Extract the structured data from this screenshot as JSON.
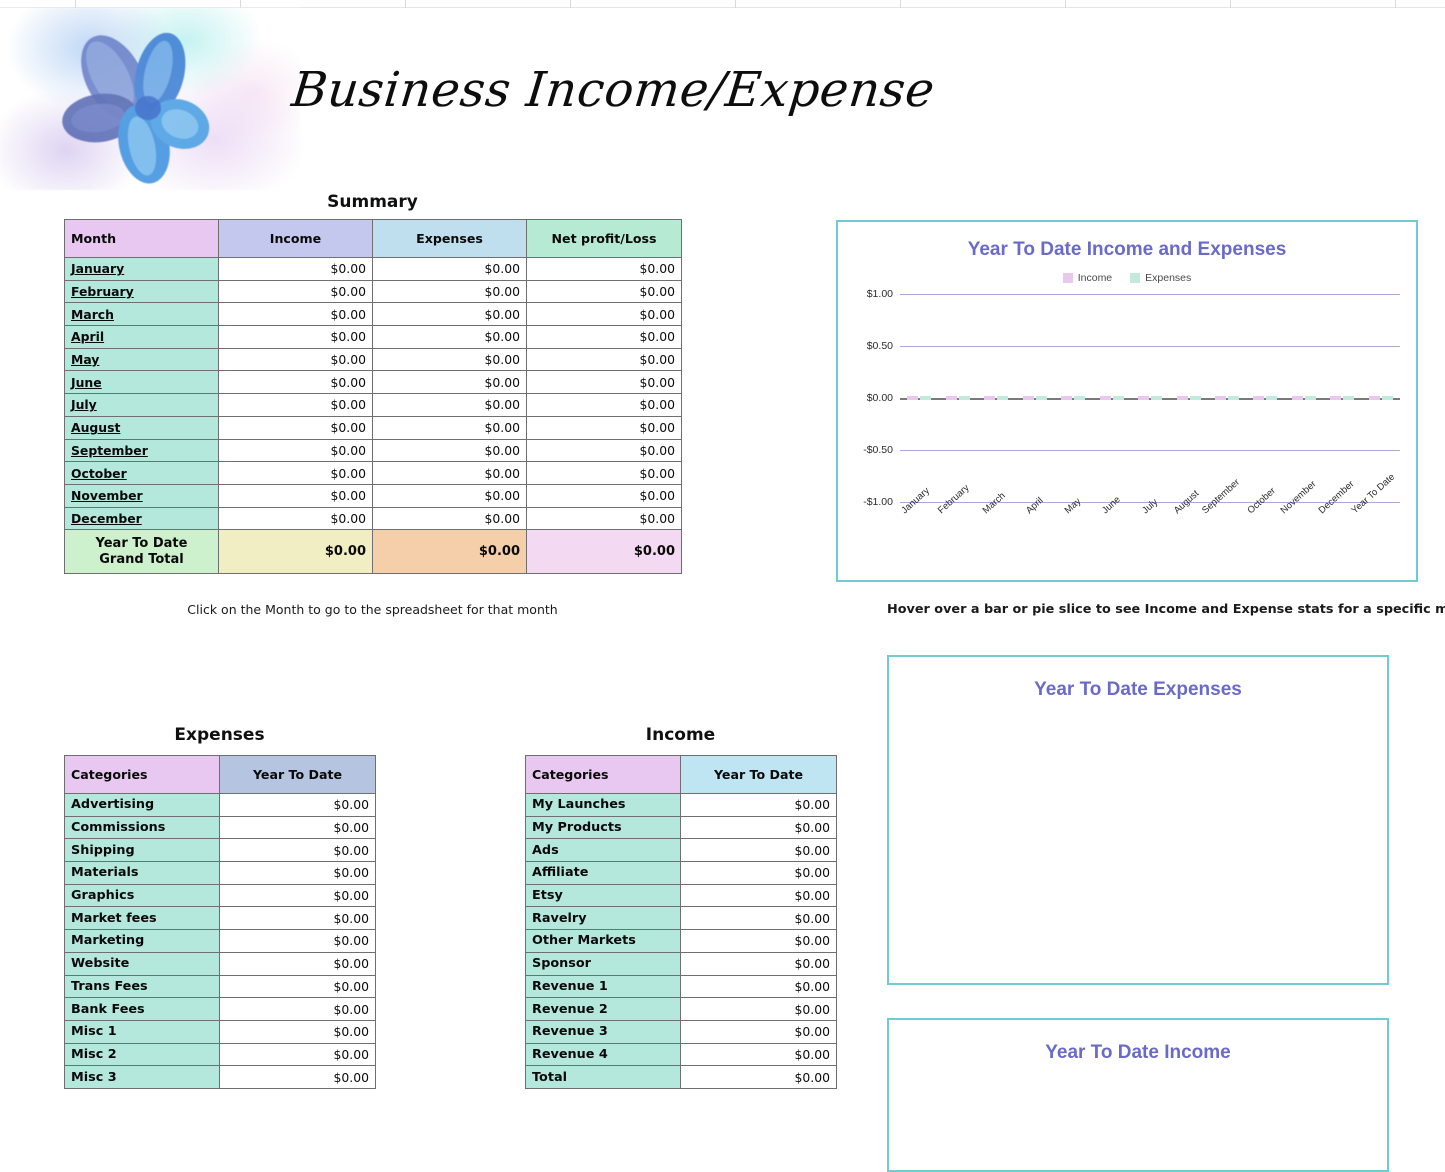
{
  "header": {
    "title": "Business Income/Expense",
    "logo_icon": "watercolor-flower-icon"
  },
  "summary": {
    "caption": "Summary",
    "columns": [
      "Month",
      "Income",
      "Expenses",
      "Net profit/Loss"
    ],
    "rows": [
      {
        "month": "January",
        "income": "$0.00",
        "expenses": "$0.00",
        "net": "$0.00"
      },
      {
        "month": "February",
        "income": "$0.00",
        "expenses": "$0.00",
        "net": "$0.00"
      },
      {
        "month": "March",
        "income": "$0.00",
        "expenses": "$0.00",
        "net": "$0.00"
      },
      {
        "month": "April",
        "income": "$0.00",
        "expenses": "$0.00",
        "net": "$0.00"
      },
      {
        "month": "May",
        "income": "$0.00",
        "expenses": "$0.00",
        "net": "$0.00"
      },
      {
        "month": "June",
        "income": "$0.00",
        "expenses": "$0.00",
        "net": "$0.00"
      },
      {
        "month": "July",
        "income": "$0.00",
        "expenses": "$0.00",
        "net": "$0.00"
      },
      {
        "month": "August",
        "income": "$0.00",
        "expenses": "$0.00",
        "net": "$0.00"
      },
      {
        "month": "September",
        "income": "$0.00",
        "expenses": "$0.00",
        "net": "$0.00"
      },
      {
        "month": "October",
        "income": "$0.00",
        "expenses": "$0.00",
        "net": "$0.00"
      },
      {
        "month": "November",
        "income": "$0.00",
        "expenses": "$0.00",
        "net": "$0.00"
      },
      {
        "month": "December",
        "income": "$0.00",
        "expenses": "$0.00",
        "net": "$0.00"
      }
    ],
    "total": {
      "label_line1": "Year To Date",
      "label_line2": "Grand Total",
      "income": "$0.00",
      "expenses": "$0.00",
      "net": "$0.00"
    },
    "footnote": "Click on the Month to go to the spreadsheet for that month"
  },
  "chart_note": "Hover over a bar or pie slice to see Income and Expense stats for a specific month",
  "expenses_table": {
    "caption": "Expenses",
    "columns": [
      "Categories",
      "Year To Date"
    ],
    "rows": [
      {
        "name": "Advertising",
        "value": "$0.00"
      },
      {
        "name": "Commissions",
        "value": "$0.00"
      },
      {
        "name": "Shipping",
        "value": "$0.00"
      },
      {
        "name": "Materials",
        "value": "$0.00"
      },
      {
        "name": "Graphics",
        "value": "$0.00"
      },
      {
        "name": "Market fees",
        "value": "$0.00"
      },
      {
        "name": "Marketing",
        "value": "$0.00"
      },
      {
        "name": "Website",
        "value": "$0.00"
      },
      {
        "name": "Trans Fees",
        "value": "$0.00"
      },
      {
        "name": "Bank Fees",
        "value": "$0.00"
      },
      {
        "name": "Misc 1",
        "value": "$0.00"
      },
      {
        "name": "Misc 2",
        "value": "$0.00"
      },
      {
        "name": "Misc 3",
        "value": "$0.00"
      }
    ]
  },
  "income_table": {
    "caption": "Income",
    "columns": [
      "Categories",
      "Year To Date"
    ],
    "rows": [
      {
        "name": "My Launches",
        "value": "$0.00"
      },
      {
        "name": "My  Products",
        "value": "$0.00"
      },
      {
        "name": "Ads",
        "value": "$0.00"
      },
      {
        "name": "Affiliate",
        "value": "$0.00"
      },
      {
        "name": "Etsy",
        "value": "$0.00"
      },
      {
        "name": "Ravelry",
        "value": "$0.00"
      },
      {
        "name": "Other Markets",
        "value": "$0.00"
      },
      {
        "name": "Sponsor",
        "value": "$0.00"
      },
      {
        "name": "Revenue 1",
        "value": "$0.00"
      },
      {
        "name": "Revenue 2",
        "value": "$0.00"
      },
      {
        "name": "Revenue 3",
        "value": "$0.00"
      },
      {
        "name": "Revenue 4",
        "value": "$0.00"
      },
      {
        "name": "Total",
        "value": "$0.00"
      }
    ]
  },
  "pie_expenses": {
    "title": "Year To Date Expenses"
  },
  "pie_income": {
    "title": "Year To Date Income"
  },
  "colors": {
    "chart_title": "#6a6ac8",
    "panel_border": "#6fcbd4",
    "income_series": "#e9c8ee",
    "expense_series": "#c3eadd",
    "gridline": "#a7a9dd",
    "header_month": "#e8c8f0",
    "header_income": "#c5c8ee",
    "header_expenses": "#bfdeee",
    "header_net": "#b7ead3",
    "row_label": "#b5e8dd",
    "total_label": "#cdf0cd",
    "total_income": "#f2eec4",
    "total_expenses": "#f5cfa9",
    "total_net": "#f4d9f2"
  },
  "chart_data": {
    "type": "bar",
    "title": "Year To Date Income and Expenses",
    "categories": [
      "January",
      "February",
      "March",
      "April",
      "May",
      "June",
      "July",
      "August",
      "September",
      "October",
      "November",
      "December",
      "Year To Date"
    ],
    "series": [
      {
        "name": "Income",
        "values": [
          0,
          0,
          0,
          0,
          0,
          0,
          0,
          0,
          0,
          0,
          0,
          0,
          0
        ],
        "color": "#e9c8ee"
      },
      {
        "name": "Expenses",
        "values": [
          0,
          0,
          0,
          0,
          0,
          0,
          0,
          0,
          0,
          0,
          0,
          0,
          0
        ],
        "color": "#c3eadd"
      }
    ],
    "ytick_labels": [
      "$1.00",
      "$0.50",
      "$0.00",
      "-$0.50",
      "-$1.00"
    ],
    "ytick_values": [
      1,
      0.5,
      0,
      -0.5,
      -1
    ],
    "ylim": [
      -1,
      1
    ],
    "xlabel": "",
    "ylabel": "",
    "grid": true,
    "legend_position": "top"
  }
}
